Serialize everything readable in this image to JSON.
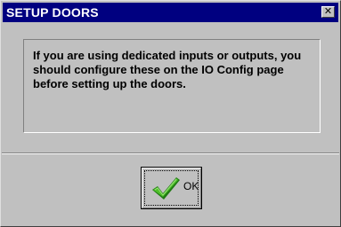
{
  "window": {
    "title": "SETUP DOORS",
    "close_glyph": "✕"
  },
  "message": {
    "text": "If you are using dedicated inputs or outputs, you should configure these on the IO Config page before setting up the doors."
  },
  "buttons": {
    "ok_label": "OK",
    "ok_icon": "green-checkmark-icon"
  },
  "colors": {
    "titlebar": "#000080",
    "dialog_face": "#c0c0c0",
    "checkmark": "#2e8b1e"
  }
}
